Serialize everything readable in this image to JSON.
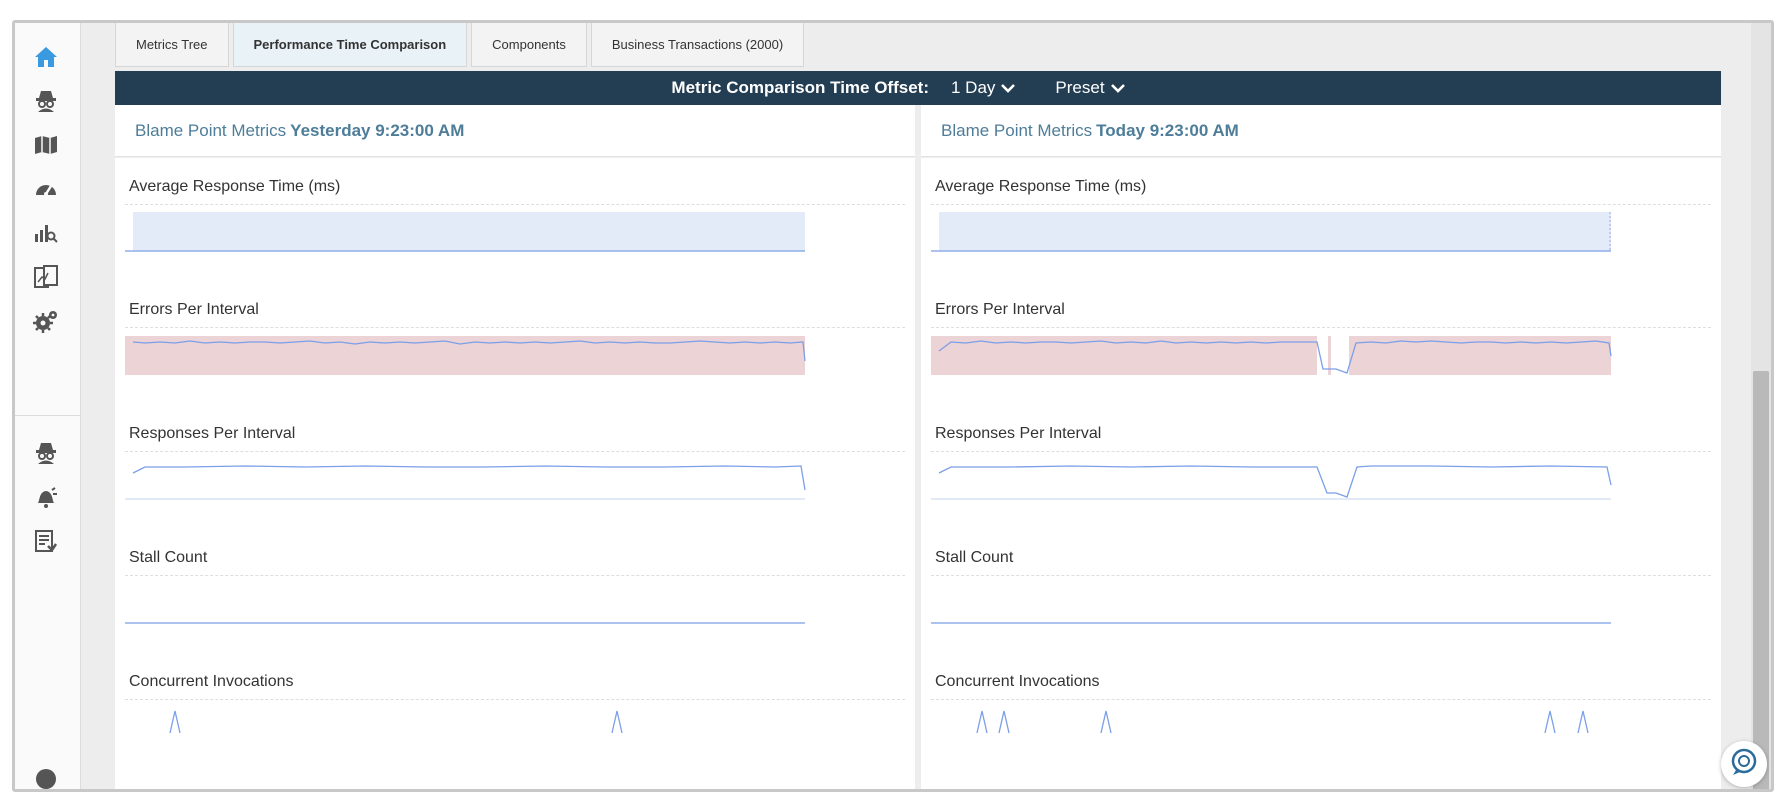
{
  "sidebar": {
    "icons": [
      "home-icon",
      "agent-spy-icon",
      "map-icon",
      "dashboard-gauge-icon",
      "chart-search-icon",
      "report-compare-icon",
      "settings-gears-icon",
      "agent-spy-secondary-icon",
      "alert-bell-icon",
      "task-list-icon",
      "help-icon"
    ]
  },
  "tabs": [
    {
      "label": "Metrics Tree",
      "active": false
    },
    {
      "label": "Performance Time Comparison",
      "active": true
    },
    {
      "label": "Components",
      "active": false
    },
    {
      "label": "Business Transactions (2000)",
      "active": false
    }
  ],
  "offset": {
    "label": "Metric Comparison Time Offset:",
    "value": "1 Day",
    "preset": "Preset"
  },
  "columns": [
    {
      "prefix": "Blame Point Metrics",
      "timestamp": "Yesterday 9:23:00 AM"
    },
    {
      "prefix": "Blame Point Metrics",
      "timestamp": "Today 9:23:00 AM"
    }
  ],
  "metrics": [
    {
      "title": "Average Response Time (ms)"
    },
    {
      "title": "Errors Per Interval"
    },
    {
      "title": "Responses Per Interval"
    },
    {
      "title": "Stall Count"
    },
    {
      "title": "Concurrent Invocations"
    }
  ],
  "colors": {
    "header_bar": "#233d53",
    "link_blue": "#4d7d99",
    "series_line": "#7b9fe8",
    "band_blue": "#e4ebf8",
    "band_red": "#ecd3d6"
  }
}
